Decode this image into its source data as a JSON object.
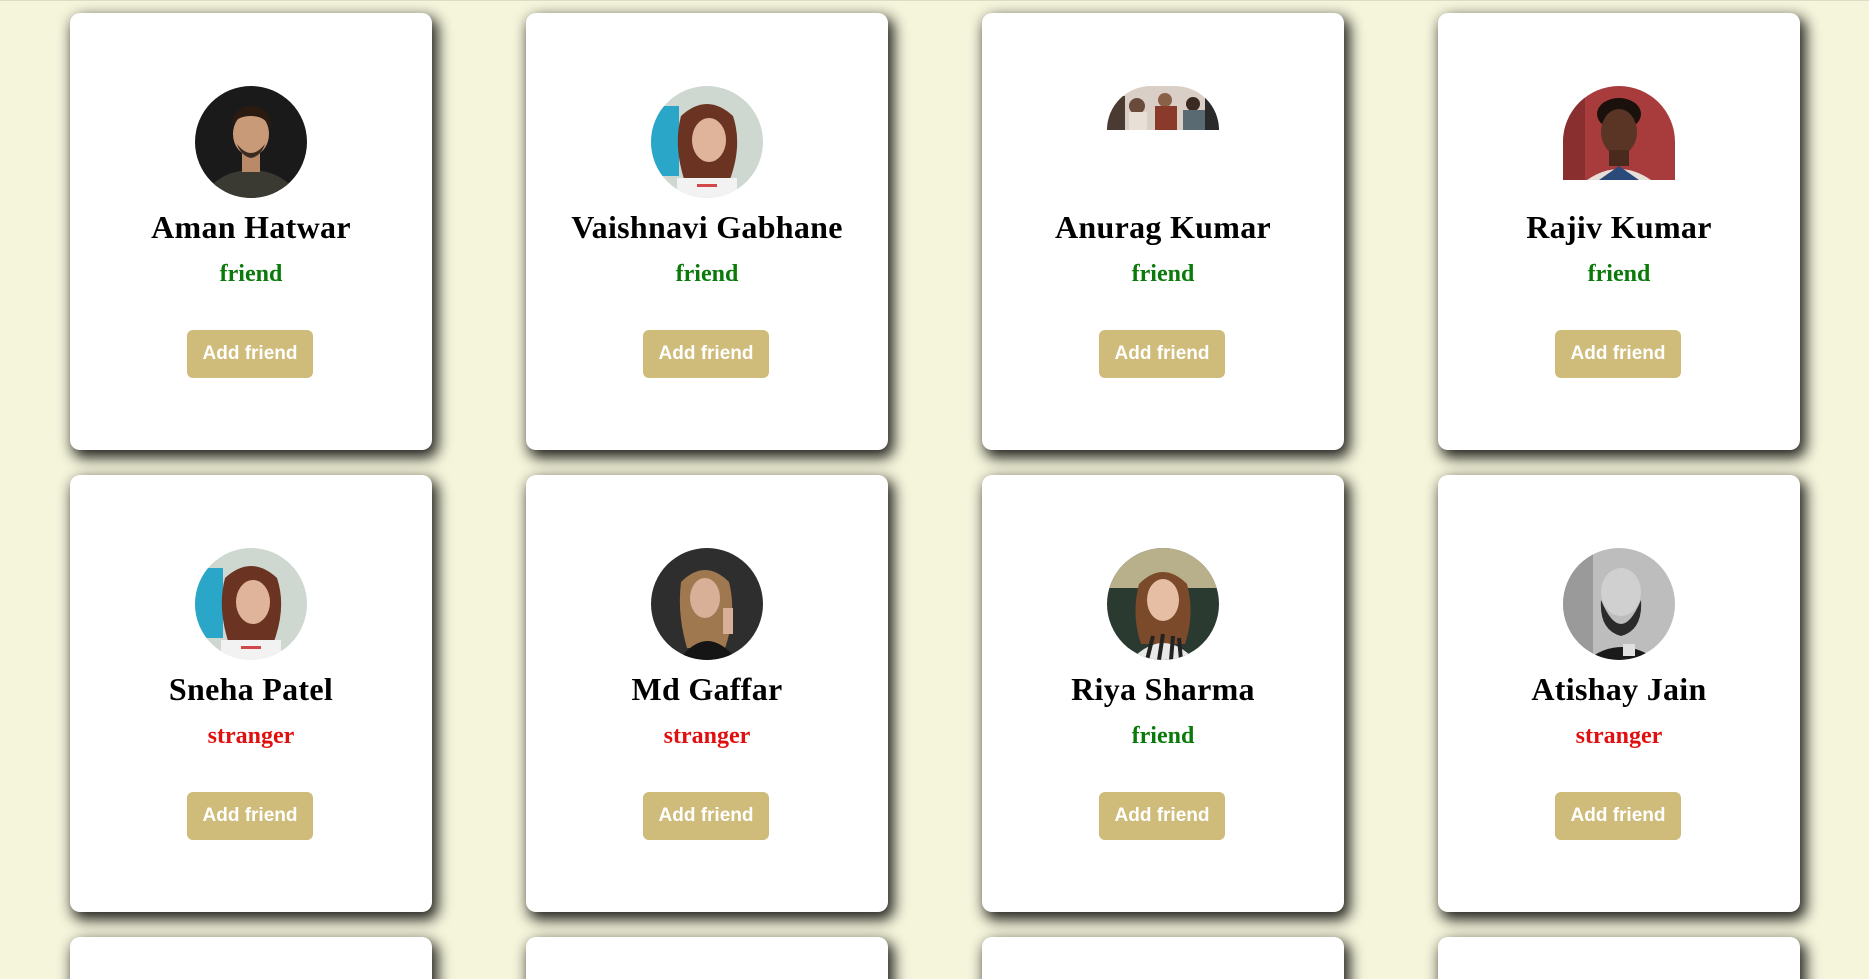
{
  "cards": [
    {
      "name": "Aman Hatwar",
      "status": "friend",
      "button_label": "Add friend",
      "avatar_icon": "man-portrait-icon"
    },
    {
      "name": "Vaishnavi Gabhane",
      "status": "friend",
      "button_label": "Add friend",
      "avatar_icon": "woman-portrait-icon"
    },
    {
      "name": "Anurag Kumar",
      "status": "friend",
      "button_label": "Add friend",
      "avatar_icon": "group-photo-icon"
    },
    {
      "name": "Rajiv Kumar",
      "status": "friend",
      "button_label": "Add friend",
      "avatar_icon": "woman-portrait-icon"
    },
    {
      "name": "Sneha Patel",
      "status": "stranger",
      "button_label": "Add friend",
      "avatar_icon": "woman-portrait-icon"
    },
    {
      "name": "Md Gaffar",
      "status": "stranger",
      "button_label": "Add friend",
      "avatar_icon": "woman-portrait-icon"
    },
    {
      "name": "Riya Sharma",
      "status": "friend",
      "button_label": "Add friend",
      "avatar_icon": "woman-portrait-icon"
    },
    {
      "name": "Atishay Jain",
      "status": "stranger",
      "button_label": "Add friend",
      "avatar_icon": "bearded-man-portrait-icon"
    }
  ],
  "colors": {
    "background": "#f5f5dc",
    "card": "#ffffff",
    "friend": "#0a7a0a",
    "stranger": "#e01010",
    "button": "#cfbc7a"
  }
}
